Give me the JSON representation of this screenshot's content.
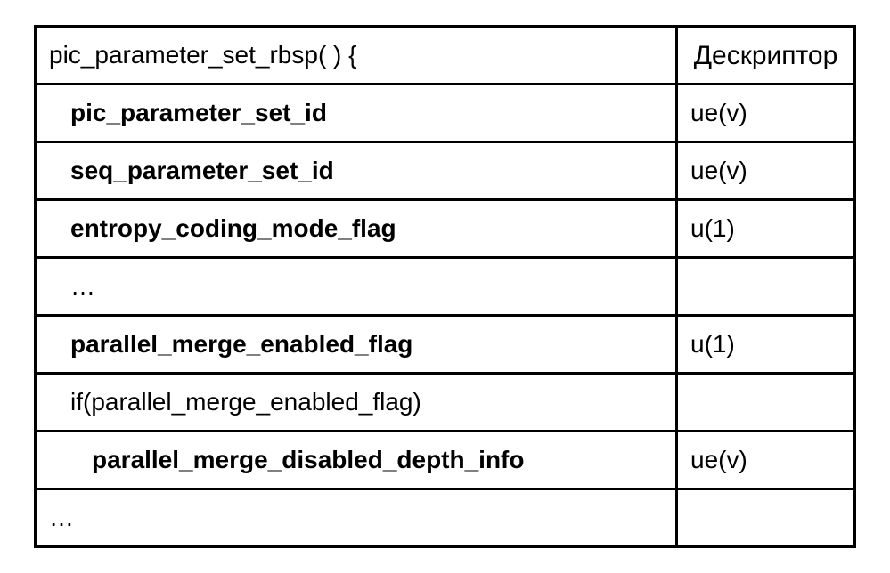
{
  "table": {
    "header": {
      "syntax": "pic_parameter_set_rbsp( ) {",
      "descriptor": "Дескриптор"
    },
    "rows": [
      {
        "syntax": "pic_parameter_set_id",
        "descriptor": "ue(v)",
        "bold": true,
        "indent": 1
      },
      {
        "syntax": "seq_parameter_set_id",
        "descriptor": "ue(v)",
        "bold": true,
        "indent": 1
      },
      {
        "syntax": "entropy_coding_mode_flag",
        "descriptor": "u(1)",
        "bold": true,
        "indent": 1
      },
      {
        "syntax": "…",
        "descriptor": "",
        "bold": false,
        "indent": 1
      },
      {
        "syntax": "parallel_merge_enabled_flag",
        "descriptor": "u(1)",
        "bold": true,
        "indent": 1
      },
      {
        "syntax": "if(parallel_merge_enabled_flag)",
        "descriptor": "",
        "bold": false,
        "indent": 1
      },
      {
        "syntax": "parallel_merge_disabled_depth_info",
        "descriptor": "ue(v)",
        "bold": true,
        "indent": 2
      },
      {
        "syntax": "…",
        "descriptor": "",
        "bold": false,
        "indent": 0
      }
    ]
  }
}
